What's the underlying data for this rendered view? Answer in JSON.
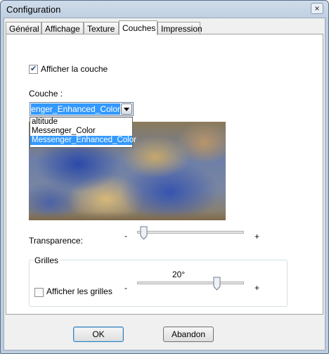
{
  "window": {
    "title": "Configuration",
    "close_glyph": "×"
  },
  "tabs": [
    {
      "label": "Général",
      "active": false
    },
    {
      "label": "Affichage",
      "active": false
    },
    {
      "label": "Texture",
      "active": false
    },
    {
      "label": "Couches",
      "active": true
    },
    {
      "label": "Impression",
      "active": false
    }
  ],
  "layer": {
    "show_label": "Afficher la couche",
    "show_checked": true,
    "couche_label": "Couche :",
    "selected_value": "Messenger_Enhanced_Color",
    "options": [
      "altitude",
      "Messenger_Color",
      "Messenger_Enhanced_Color"
    ]
  },
  "transparency": {
    "label": "Transparence:",
    "minus": "-",
    "plus": "+",
    "value_fraction": 0.0
  },
  "grids": {
    "title": "Grilles",
    "show_label": "Afficher les grilles",
    "show_checked": false,
    "value_label": "20°",
    "minus": "-",
    "plus": "+",
    "value_fraction": 0.72
  },
  "buttons": {
    "ok": "OK",
    "cancel": "Abandon"
  },
  "colors": {
    "selection": "#3399ff",
    "title_bar": "#bccde0"
  }
}
